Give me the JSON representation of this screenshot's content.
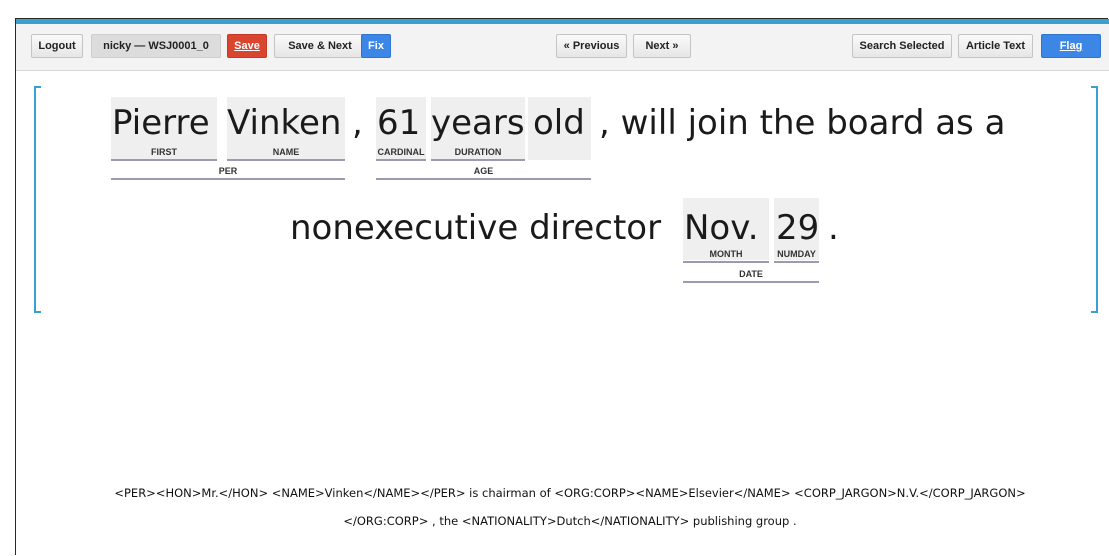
{
  "toolbar": {
    "logout": "Logout",
    "doc": "nicky — WSJ0001_0",
    "save": "Save",
    "save_next": "Save & Next",
    "fix": "Fix",
    "previous": "« Previous",
    "next": "Next »",
    "search_selected": "Search Selected",
    "article_text": "Article Text",
    "flag": "Flag"
  },
  "sentence": {
    "tokens": [
      "Pierre",
      "Vinken",
      ",",
      "61",
      "years",
      "old",
      ",",
      "will",
      "join",
      "the",
      "board",
      "as",
      "a",
      "nonexecutive",
      "director",
      "Nov.",
      "29",
      "."
    ],
    "line1_plain": ", will join the board as a",
    "line2_plain": "nonexecutive director"
  },
  "labels": {
    "first": "FIRST",
    "name": "NAME",
    "per": "PER",
    "cardinal": "CARDINAL",
    "duration": "DURATION",
    "age": "AGE",
    "month": "MONTH",
    "numday": "NUMDAY",
    "date": "DATE"
  },
  "xml_text": {
    "line1": "<PER><HON>Mr.</HON> <NAME>Vinken</NAME></PER> is chairman of <ORG:CORP><NAME>Elsevier</NAME> <CORP_JARGON>N.V.</CORP_JARGON>",
    "line2": "</ORG:CORP> , the <NATIONALITY>Dutch</NATIONALITY> publishing group ."
  },
  "colors": {
    "accent": "#3aa0cf",
    "save": "#d9452f",
    "blue": "#3c86e6"
  }
}
